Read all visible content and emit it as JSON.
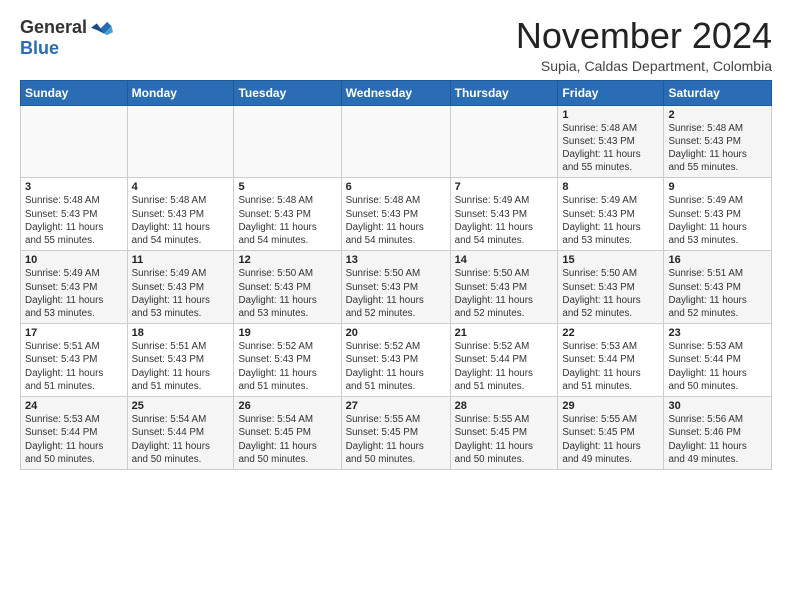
{
  "logo": {
    "general": "General",
    "blue": "Blue"
  },
  "header": {
    "month": "November 2024",
    "location": "Supia, Caldas Department, Colombia"
  },
  "weekdays": [
    "Sunday",
    "Monday",
    "Tuesday",
    "Wednesday",
    "Thursday",
    "Friday",
    "Saturday"
  ],
  "weeks": [
    [
      {
        "day": "",
        "info": ""
      },
      {
        "day": "",
        "info": ""
      },
      {
        "day": "",
        "info": ""
      },
      {
        "day": "",
        "info": ""
      },
      {
        "day": "",
        "info": ""
      },
      {
        "day": "1",
        "info": "Sunrise: 5:48 AM\nSunset: 5:43 PM\nDaylight: 11 hours\nand 55 minutes."
      },
      {
        "day": "2",
        "info": "Sunrise: 5:48 AM\nSunset: 5:43 PM\nDaylight: 11 hours\nand 55 minutes."
      }
    ],
    [
      {
        "day": "3",
        "info": "Sunrise: 5:48 AM\nSunset: 5:43 PM\nDaylight: 11 hours\nand 55 minutes."
      },
      {
        "day": "4",
        "info": "Sunrise: 5:48 AM\nSunset: 5:43 PM\nDaylight: 11 hours\nand 54 minutes."
      },
      {
        "day": "5",
        "info": "Sunrise: 5:48 AM\nSunset: 5:43 PM\nDaylight: 11 hours\nand 54 minutes."
      },
      {
        "day": "6",
        "info": "Sunrise: 5:48 AM\nSunset: 5:43 PM\nDaylight: 11 hours\nand 54 minutes."
      },
      {
        "day": "7",
        "info": "Sunrise: 5:49 AM\nSunset: 5:43 PM\nDaylight: 11 hours\nand 54 minutes."
      },
      {
        "day": "8",
        "info": "Sunrise: 5:49 AM\nSunset: 5:43 PM\nDaylight: 11 hours\nand 53 minutes."
      },
      {
        "day": "9",
        "info": "Sunrise: 5:49 AM\nSunset: 5:43 PM\nDaylight: 11 hours\nand 53 minutes."
      }
    ],
    [
      {
        "day": "10",
        "info": "Sunrise: 5:49 AM\nSunset: 5:43 PM\nDaylight: 11 hours\nand 53 minutes."
      },
      {
        "day": "11",
        "info": "Sunrise: 5:49 AM\nSunset: 5:43 PM\nDaylight: 11 hours\nand 53 minutes."
      },
      {
        "day": "12",
        "info": "Sunrise: 5:50 AM\nSunset: 5:43 PM\nDaylight: 11 hours\nand 53 minutes."
      },
      {
        "day": "13",
        "info": "Sunrise: 5:50 AM\nSunset: 5:43 PM\nDaylight: 11 hours\nand 52 minutes."
      },
      {
        "day": "14",
        "info": "Sunrise: 5:50 AM\nSunset: 5:43 PM\nDaylight: 11 hours\nand 52 minutes."
      },
      {
        "day": "15",
        "info": "Sunrise: 5:50 AM\nSunset: 5:43 PM\nDaylight: 11 hours\nand 52 minutes."
      },
      {
        "day": "16",
        "info": "Sunrise: 5:51 AM\nSunset: 5:43 PM\nDaylight: 11 hours\nand 52 minutes."
      }
    ],
    [
      {
        "day": "17",
        "info": "Sunrise: 5:51 AM\nSunset: 5:43 PM\nDaylight: 11 hours\nand 51 minutes."
      },
      {
        "day": "18",
        "info": "Sunrise: 5:51 AM\nSunset: 5:43 PM\nDaylight: 11 hours\nand 51 minutes."
      },
      {
        "day": "19",
        "info": "Sunrise: 5:52 AM\nSunset: 5:43 PM\nDaylight: 11 hours\nand 51 minutes."
      },
      {
        "day": "20",
        "info": "Sunrise: 5:52 AM\nSunset: 5:43 PM\nDaylight: 11 hours\nand 51 minutes."
      },
      {
        "day": "21",
        "info": "Sunrise: 5:52 AM\nSunset: 5:44 PM\nDaylight: 11 hours\nand 51 minutes."
      },
      {
        "day": "22",
        "info": "Sunrise: 5:53 AM\nSunset: 5:44 PM\nDaylight: 11 hours\nand 51 minutes."
      },
      {
        "day": "23",
        "info": "Sunrise: 5:53 AM\nSunset: 5:44 PM\nDaylight: 11 hours\nand 50 minutes."
      }
    ],
    [
      {
        "day": "24",
        "info": "Sunrise: 5:53 AM\nSunset: 5:44 PM\nDaylight: 11 hours\nand 50 minutes."
      },
      {
        "day": "25",
        "info": "Sunrise: 5:54 AM\nSunset: 5:44 PM\nDaylight: 11 hours\nand 50 minutes."
      },
      {
        "day": "26",
        "info": "Sunrise: 5:54 AM\nSunset: 5:45 PM\nDaylight: 11 hours\nand 50 minutes."
      },
      {
        "day": "27",
        "info": "Sunrise: 5:55 AM\nSunset: 5:45 PM\nDaylight: 11 hours\nand 50 minutes."
      },
      {
        "day": "28",
        "info": "Sunrise: 5:55 AM\nSunset: 5:45 PM\nDaylight: 11 hours\nand 50 minutes."
      },
      {
        "day": "29",
        "info": "Sunrise: 5:55 AM\nSunset: 5:45 PM\nDaylight: 11 hours\nand 49 minutes."
      },
      {
        "day": "30",
        "info": "Sunrise: 5:56 AM\nSunset: 5:46 PM\nDaylight: 11 hours\nand 49 minutes."
      }
    ]
  ]
}
